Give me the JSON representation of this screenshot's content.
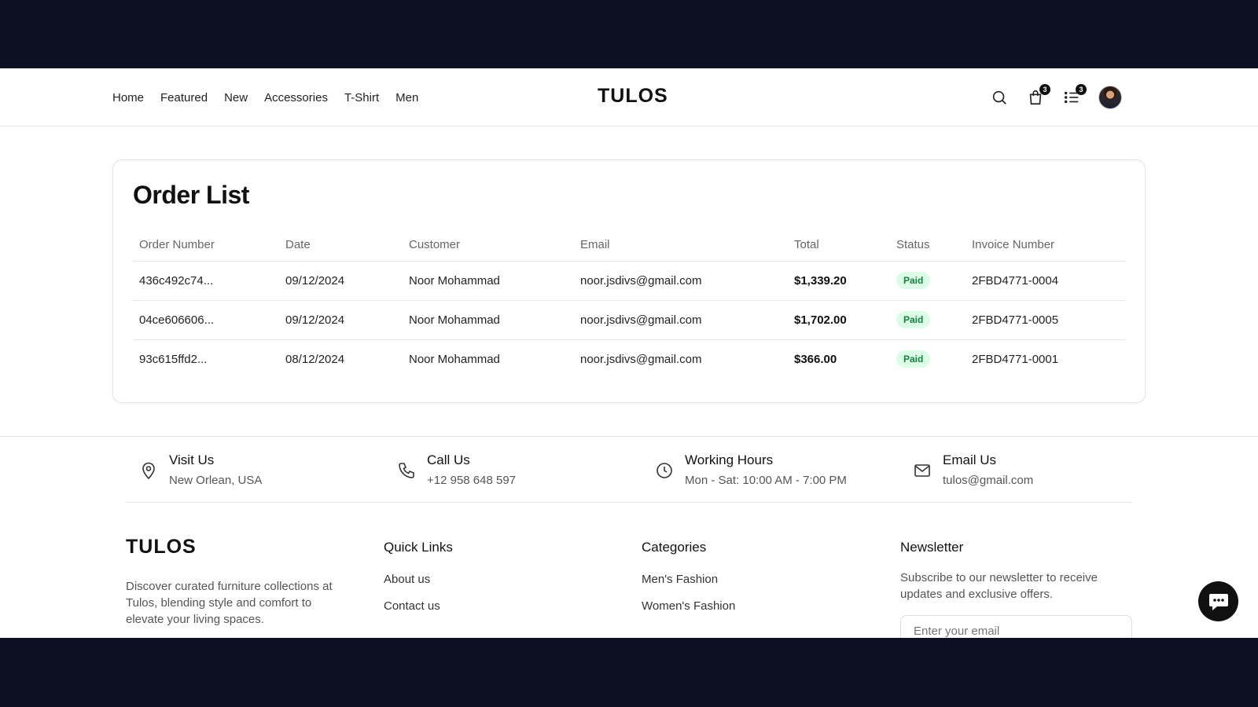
{
  "nav": {
    "items": [
      "Home",
      "Featured",
      "New",
      "Accessories",
      "T-Shirt",
      "Men"
    ],
    "logo": "TULOS",
    "cart_count": "3",
    "orders_count": "3"
  },
  "orders": {
    "title": "Order List",
    "columns": [
      "Order Number",
      "Date",
      "Customer",
      "Email",
      "Total",
      "Status",
      "Invoice Number"
    ],
    "rows": [
      {
        "order": "436c492c74...",
        "date": "09/12/2024",
        "customer": "Noor Mohammad",
        "email": "noor.jsdivs@gmail.com",
        "total": "$1,339.20",
        "status": "Paid",
        "invoice": "2FBD4771-0004"
      },
      {
        "order": "04ce606606...",
        "date": "09/12/2024",
        "customer": "Noor Mohammad",
        "email": "noor.jsdivs@gmail.com",
        "total": "$1,702.00",
        "status": "Paid",
        "invoice": "2FBD4771-0005"
      },
      {
        "order": "93c615ffd2...",
        "date": "08/12/2024",
        "customer": "Noor Mohammad",
        "email": "noor.jsdivs@gmail.com",
        "total": "$366.00",
        "status": "Paid",
        "invoice": "2FBD4771-0001"
      }
    ]
  },
  "contact": {
    "visit": {
      "title": "Visit Us",
      "value": "New Orlean, USA"
    },
    "call": {
      "title": "Call Us",
      "value": "+12 958 648 597"
    },
    "hours": {
      "title": "Working Hours",
      "value": "Mon - Sat: 10:00 AM - 7:00 PM"
    },
    "email": {
      "title": "Email Us",
      "value": "tulos@gmail.com"
    }
  },
  "footer": {
    "logo": "TULOS",
    "description": "Discover curated furniture collections at Tulos, blending style and comfort to elevate your living spaces.",
    "quick_links": {
      "title": "Quick Links",
      "items": [
        "About us",
        "Contact us"
      ]
    },
    "categories": {
      "title": "Categories",
      "items": [
        "Men's Fashion",
        "Women's Fashion"
      ]
    },
    "newsletter": {
      "title": "Newsletter",
      "text": "Subscribe to our newsletter to receive updates and exclusive offers.",
      "placeholder": "Enter your email"
    }
  },
  "colors": {
    "page_frame": "#0b1120",
    "paid_bg": "#dcfce7",
    "paid_text": "#15803d"
  }
}
